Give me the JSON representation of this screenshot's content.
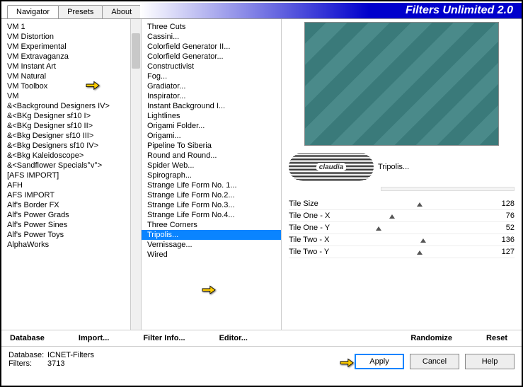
{
  "app": {
    "title": "Filters Unlimited 2.0"
  },
  "tabs": [
    {
      "label": "Navigator"
    },
    {
      "label": "Presets"
    },
    {
      "label": "About"
    }
  ],
  "categories": [
    "VM 1",
    "VM Distortion",
    "VM Experimental",
    "VM Extravaganza",
    "VM Instant Art",
    "VM Natural",
    "VM Toolbox",
    "VM",
    "&<Background Designers IV>",
    "&<BKg Designer sf10 I>",
    "&<BKg Designer sf10 II>",
    "&<Bkg Designer sf10 III>",
    "&<Bkg Designers sf10 IV>",
    "&<Bkg Kaleidoscope>",
    "&<Sandflower Specials°v°>",
    "[AFS IMPORT]",
    "AFH",
    "AFS IMPORT",
    "Alf's Border FX",
    "Alf's Power Grads",
    "Alf's Power Sines",
    "Alf's Power Toys",
    "AlphaWorks"
  ],
  "filters": [
    "Three Cuts",
    "Cassini...",
    "Colorfield Generator II...",
    "Colorfield Generator...",
    "Constructivist",
    "Fog...",
    "Gradiator...",
    "Inspirator...",
    "Instant Background I...",
    "Lightlines",
    "Origami Folder...",
    "Origami...",
    "Pipeline To Siberia",
    "Round and Round...",
    "Spider Web...",
    "Spirograph...",
    "Strange Life Form No. 1...",
    "Strange Life Form No.2...",
    "Strange Life Form No.3...",
    "Strange Life Form No.4...",
    "Three Corners",
    "Tripolis...",
    "Vernissage...",
    "Wired"
  ],
  "selected_filter": "Tripolis...",
  "badge": {
    "logo": "claudia"
  },
  "params": [
    {
      "label": "Tile Size",
      "value": 128,
      "pos": 50
    },
    {
      "label": "Tile One - X",
      "value": 76,
      "pos": 30
    },
    {
      "label": "Tile One - Y",
      "value": 52,
      "pos": 20
    },
    {
      "label": "Tile Two - X",
      "value": 136,
      "pos": 53
    },
    {
      "label": "Tile Two - Y",
      "value": 127,
      "pos": 50
    }
  ],
  "toolbar": {
    "database": "Database",
    "import": "Import...",
    "filterinfo": "Filter Info...",
    "editor": "Editor...",
    "randomize": "Randomize",
    "reset": "Reset"
  },
  "footer": {
    "db_label": "Database:",
    "db_value": "ICNET-Filters",
    "filters_label": "Filters:",
    "filters_value": "3713",
    "apply": "Apply",
    "cancel": "Cancel",
    "help": "Help"
  }
}
